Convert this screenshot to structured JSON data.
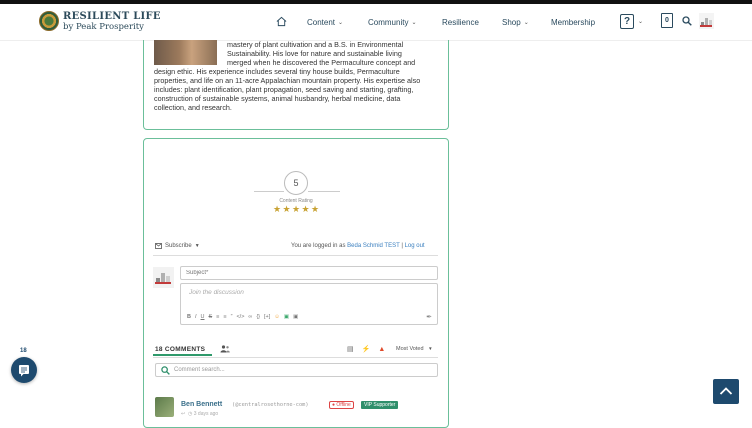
{
  "header": {
    "brand_title": "RESILIENT LIFE",
    "brand_subtitle": "by Peak Prosperity",
    "nav": [
      {
        "label": "Content",
        "has_dropdown": true
      },
      {
        "label": "Community",
        "has_dropdown": true
      },
      {
        "label": "Resilience",
        "has_dropdown": false
      },
      {
        "label": "Shop",
        "has_dropdown": true
      },
      {
        "label": "Membership",
        "has_dropdown": false
      }
    ],
    "help_label": "?",
    "cart_count": "0"
  },
  "author_bio": {
    "line1": "mastery of plant cultivation and a B.S. in Environmental",
    "line2": "Sustainability. His love for nature and sustainable living",
    "line3": "merged when he discovered the Permaculture concept and",
    "line4": "design ethic. His experience includes several tiny house builds, Permaculture",
    "line5": "properties, and life on an 11-acre Appalachian mountain property. His expertise also",
    "line6": "includes: plant identification, plant propagation, seed saving and starting, grafting,",
    "line7": "construction of sustainable systems, animal husbandry, herbal medicine, data",
    "line8": "collection, and research."
  },
  "rating": {
    "value": "5",
    "label": "Content Rating",
    "stars": 5
  },
  "comment_form": {
    "subscribe_label": "Subscribe",
    "logged_in_prefix": "You are logged in as",
    "user_name": "Beda Schmid TEST",
    "separator": "|",
    "logout_label": "Log out",
    "subject_placeholder": "Subject*",
    "body_placeholder": "Join the discussion"
  },
  "comments": {
    "count_label": "18 COMMENTS",
    "sort_label": "Most Voted",
    "search_placeholder": "Comment search...",
    "first": {
      "name": "Ben Bennett",
      "handle": "(@centralrosethorne-com)",
      "status": "Offline",
      "badge": "VIP Supporter",
      "time": "3 days ago"
    }
  },
  "floating": {
    "count": "18"
  },
  "colors": {
    "accent_green": "#6bbf9a",
    "navy": "#1e4a6e",
    "star_gold": "#c8a233",
    "link_blue": "#3a7fbf"
  }
}
